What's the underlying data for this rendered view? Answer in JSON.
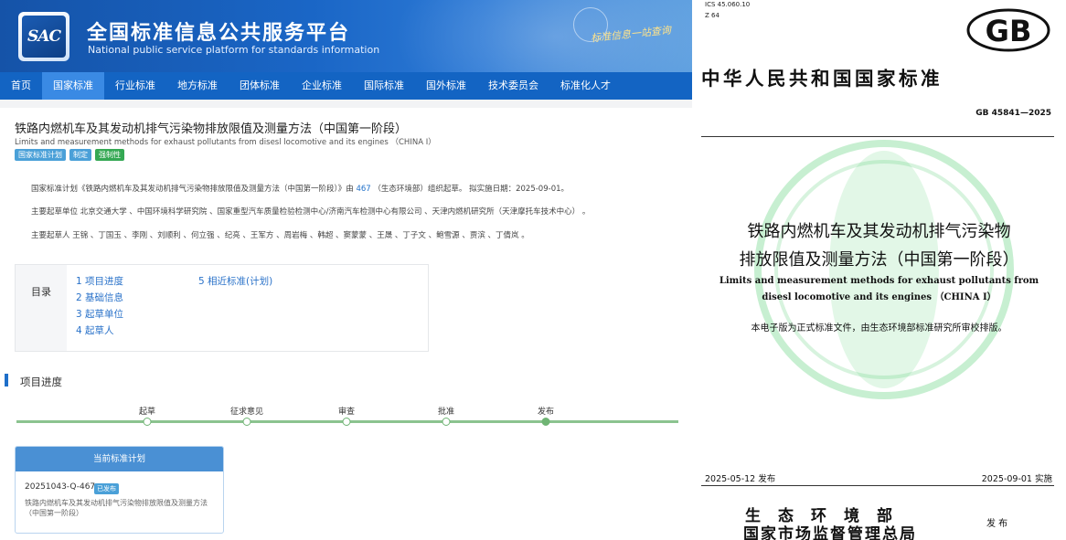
{
  "site": {
    "logo_text": "SAC",
    "title": "全国标准信息公共服务平台",
    "subtitle": "National public service platform  for standards information",
    "slogan": "标准信息一站查询",
    "nav": [
      "首页",
      "国家标准",
      "行业标准",
      "地方标准",
      "团体标准",
      "企业标准",
      "国际标准",
      "国外标准",
      "技术委员会",
      "标准化人才"
    ],
    "nav_active": "国家标准"
  },
  "standard": {
    "title": "铁路内燃机车及其发动机排气污染物排放限值及测量方法（中国第一阶段）",
    "title_en": "Limits and measurement methods for exhaust pollutants from disesl locomotive and its engines  （CHINA I）",
    "badges": [
      "国家标准计划",
      "制定",
      "强制性"
    ],
    "plan_line_pre": "国家标准计划《铁路内燃机车及其发动机排气污染物排放限值及测量方法（中国第一阶段）》由",
    "plan_tc": "467",
    "plan_line_post": "（生态环境部）组织起草。 拟实施日期：2025-09-01。",
    "drafting_units": "主要起草单位 北京交通大学 、中国环境科学研究院 、国家重型汽车质量检验检测中心/济南汽车检测中心有限公司 、天津内燃机研究所（天津摩托车技术中心） 。",
    "drafters": "主要起草人 王锦 、丁国玉 、李刚 、刘顺利 、何立强 、纪亮 、王军方 、周岩梅 、韩超 、窦蒙蒙 、王晟 、丁子文 、鲍雪源 、贾滨 、丁倩岚 。"
  },
  "toc": {
    "label": "目录",
    "items": [
      "1 项目进度",
      "2 基础信息",
      "3 起草单位",
      "4 起草人",
      "5 相近标准(计划)"
    ]
  },
  "progress": {
    "title": "项目进度",
    "steps": [
      "起草",
      "征求意见",
      "审查",
      "批准",
      "发布"
    ],
    "current_step": "发布"
  },
  "plan_card": {
    "header": "当前标准计划",
    "code": "20251043-Q-467",
    "status": "已发布",
    "name_line1": "铁路内燃机车及其发动机排气污染物排放限值及测量方法",
    "name_line2": "（中国第一阶段）"
  },
  "document": {
    "ics": "ICS 45.060.10",
    "classification": "Z 64",
    "gb_logo": "GB",
    "national_standard": "中华人民共和国国家标准",
    "number": "GB 45841—2025",
    "title_cn_line1": "铁路内燃机车及其发动机排气污染物",
    "title_cn_line2": "排放限值及测量方法（中国第一阶段）",
    "title_en_line1": "Limits and measurement methods for exhaust pollutants from",
    "title_en_line2": "disesl locomotive and its engines  （CHINA I）",
    "note": "本电子版为正式标准文件，由生态环境部标准研究所审校排版。",
    "published": "2025-05-12 发布",
    "implemented": "2025-09-01 实施",
    "issuer_line1": "生态环境部",
    "issuer_line2": "国家市场监督管理总局",
    "issue_word": "发 布"
  },
  "colors": {
    "banner": "#1a66c6",
    "nav": "#1364c3",
    "nav_active": "#3a8ae4",
    "link": "#1e6fc9",
    "progress_track": "#8bc38f",
    "watermark": "#5fd07a"
  }
}
